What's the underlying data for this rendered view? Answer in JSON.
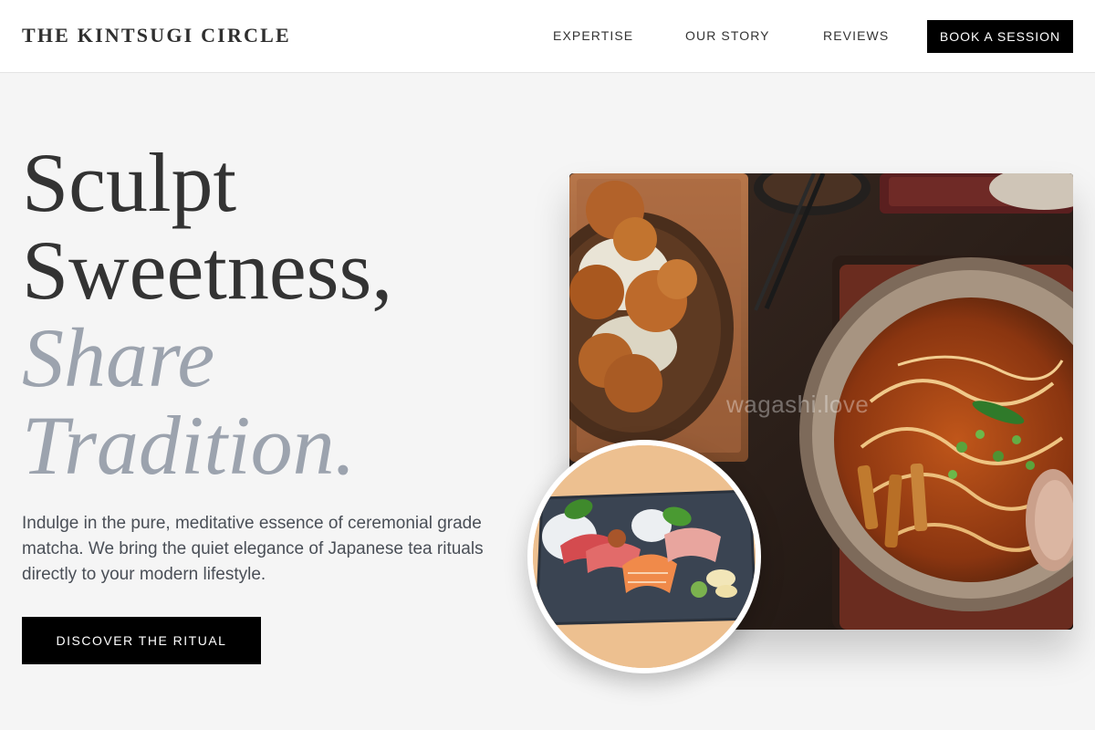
{
  "brand": {
    "name": "THE KINTSUGI CIRCLE"
  },
  "nav": {
    "items": [
      {
        "label": "EXPERTISE"
      },
      {
        "label": "OUR STORY"
      },
      {
        "label": "REVIEWS"
      }
    ],
    "cta_label": "BOOK A SESSION"
  },
  "hero": {
    "title_line1": "Sculpt",
    "title_line2": "Sweetness,",
    "title_accent_line1": "Share",
    "title_accent_line2": "Tradition.",
    "description": "Indulge in the pure, meditative essence of ceremonial grade matcha. We bring the quiet elegance of Japanese tea rituals directly to your modern lifestyle.",
    "cta_label": "DISCOVER THE RITUAL"
  },
  "images": {
    "main_photo_icon": "japanese-meal-photo",
    "main_photo_watermark": "wagashi.love",
    "circle_photo_icon": "sashimi-plate-photo"
  },
  "colors": {
    "accent_text": "#9ca3ae",
    "button_bg": "#000000",
    "page_bg": "#f5f5f5"
  }
}
